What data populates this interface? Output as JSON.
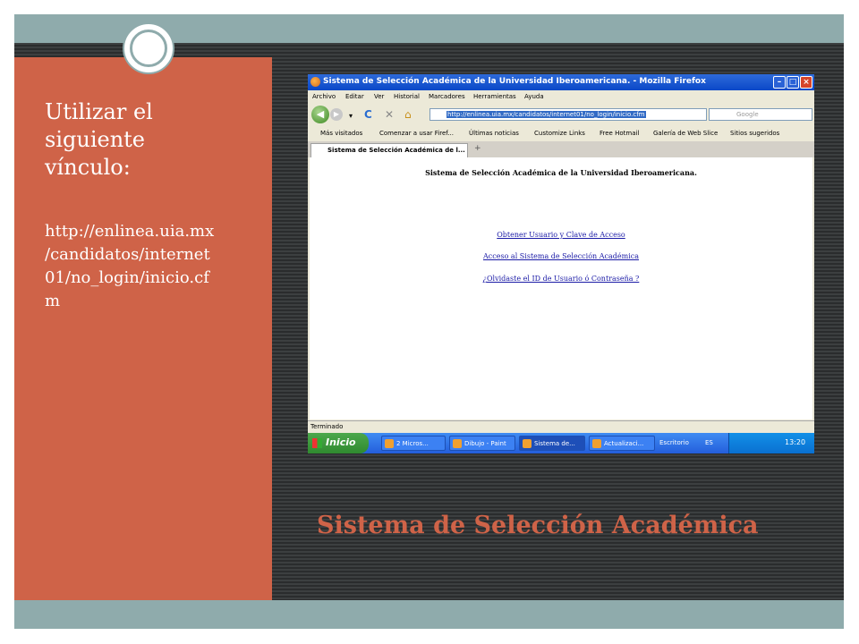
{
  "slide": {
    "lead_lines": [
      "Utilizar el",
      "siguiente",
      "vínculo:"
    ],
    "url_lines": [
      "http://enlinea.uia.mx",
      "/candidatos/internet",
      "01/no_login/inicio.cf",
      "m"
    ],
    "title": "Sistema de Selección  Académica",
    "colors": {
      "accent": "#cf6348",
      "teal": "#8fabac",
      "dark": "#2f3233"
    }
  },
  "browser": {
    "window_title": "Sistema de Selección Académica de la Universidad Iberoamericana. - Mozilla Firefox",
    "menu": [
      "Archivo",
      "Editar",
      "Ver",
      "Historial",
      "Marcadores",
      "Herramientas",
      "Ayuda"
    ],
    "address": "http://enlinea.uia.mx/candidatos/internet01/no_login/inicio.cfm",
    "search_placeholder": "Google",
    "bookmarks": [
      "Más visitados",
      "Comenzar a usar Firef...",
      "Últimas noticias",
      "Customize Links",
      "Free Hotmail",
      "Galería de Web Slice",
      "Sitios sugeridos"
    ],
    "tab_label": "Sistema de Selección Académica de l...",
    "page": {
      "heading": "Sistema de Selección Académica de la Universidad Iberoamericana.",
      "links": [
        "Obtener Usuario y Clave de Acceso",
        "Acceso al Sistema de Selección Académica",
        "¿Olvidaste el ID de Usuario ó Contraseña ?"
      ]
    },
    "status": "Terminado"
  },
  "taskbar": {
    "start": "Inicio",
    "tasks": [
      "2 Micros...",
      "Dibujo - Paint",
      "Sistema de...",
      "Actualizaci..."
    ],
    "desktop_label": "Escritorio",
    "language": "ES",
    "clock": "13:20"
  }
}
